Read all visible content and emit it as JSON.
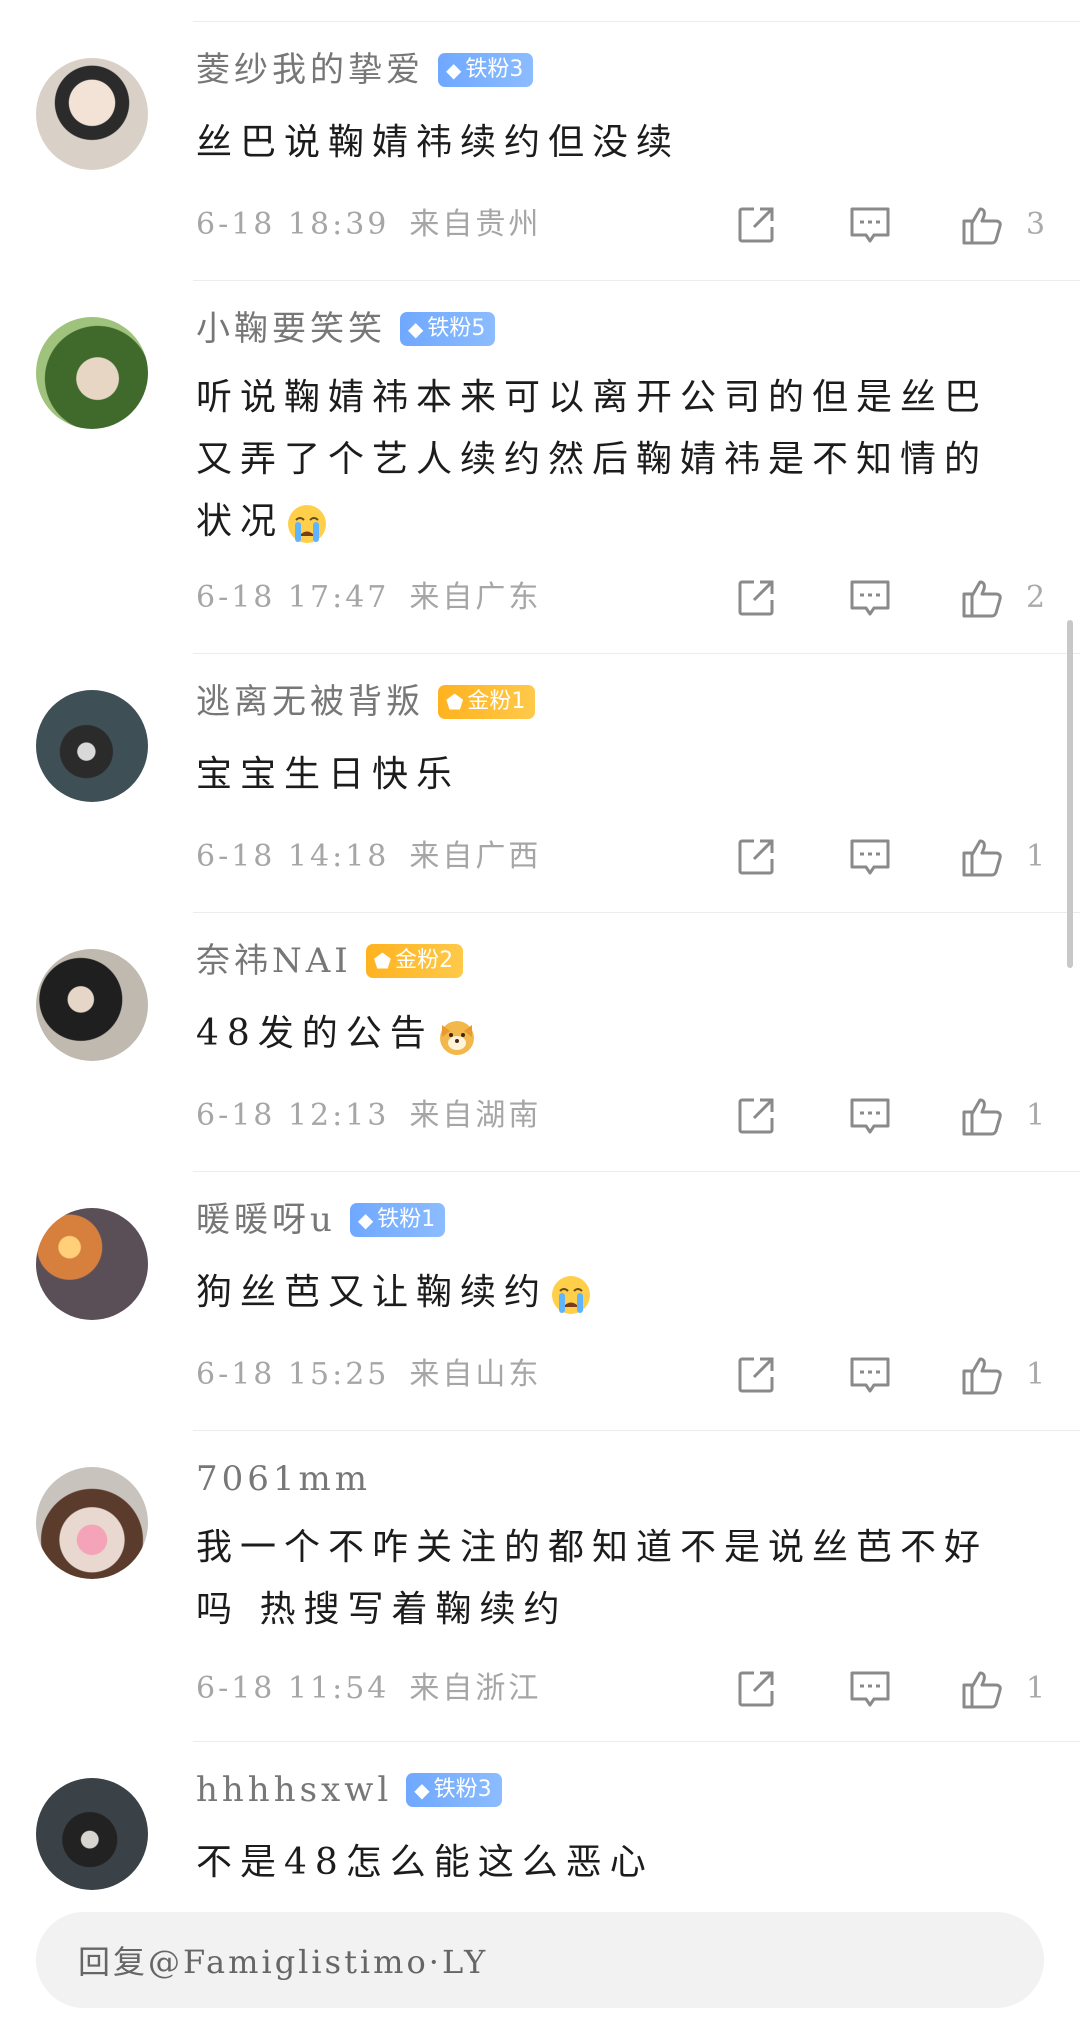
{
  "comments": [
    {
      "username": "菱纱我的挚爱",
      "badge": {
        "label": "铁粉3",
        "type": "iron"
      },
      "content": "丝巴说鞠婧祎续约但没续",
      "time": "6-18 18:39",
      "location": "来自贵州",
      "likes": "3",
      "emoji": null
    },
    {
      "username": "小鞠要笑笑",
      "badge": {
        "label": "铁粉5",
        "type": "iron"
      },
      "content": "听说鞠婧祎本来可以离开公司的但是丝巴又弄了个艺人续约然后鞠婧祎是不知情的状况",
      "time": "6-18 17:47",
      "location": "来自广东",
      "likes": "2",
      "emoji": "crying-face-icon"
    },
    {
      "username": "逃离无被背叛",
      "badge": {
        "label": "金粉1",
        "type": "gold"
      },
      "content": "宝宝生日快乐",
      "time": "6-18 14:18",
      "location": "来自广西",
      "likes": "1",
      "emoji": null
    },
    {
      "username": "奈祎NAI",
      "badge": {
        "label": "金粉2",
        "type": "gold"
      },
      "content": "48发的公告",
      "time": "6-18 12:13",
      "location": "来自湖南",
      "likes": "1",
      "emoji": "dog-face-icon"
    },
    {
      "username": "暖暖呀u",
      "badge": {
        "label": "铁粉1",
        "type": "iron"
      },
      "content": "狗丝芭又让鞠续约",
      "time": "6-18 15:25",
      "location": "来自山东",
      "likes": "1",
      "emoji": "crying-face-icon"
    },
    {
      "username": "7061mm",
      "badge": null,
      "content": "我一个不咋关注的都知道不是说丝芭不好吗 热搜写着鞠续约",
      "time": "6-18 11:54",
      "location": "来自浙江",
      "likes": "1",
      "emoji": null
    },
    {
      "username": "hhhhsxwl",
      "badge": {
        "label": "铁粉3",
        "type": "iron"
      },
      "content": "不是48怎么能这么恶心",
      "time": null,
      "location": null,
      "likes": null,
      "emoji": null
    }
  ],
  "reply": {
    "placeholder": "回复@Famiglistimo·LY"
  },
  "colors": {
    "iron_badge": "#6fa8ff",
    "gold_badge": "#ffb21f",
    "meta_text": "#a6a6a6",
    "separator": "#ececec"
  },
  "icons": [
    "share-icon",
    "comment-icon",
    "like-icon"
  ]
}
